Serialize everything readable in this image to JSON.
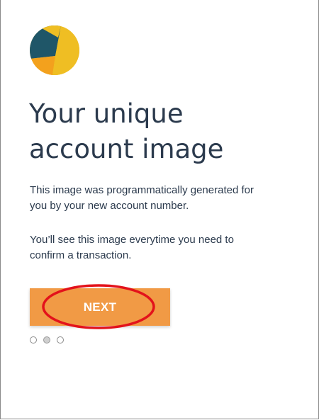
{
  "onboarding": {
    "account_image": {
      "icon": "account-identicon",
      "colors": {
        "yellow": "#efbe23",
        "teal": "#1f5668",
        "orange": "#f3a11d"
      }
    },
    "title_line_1": "Your unique",
    "title_line_2": "account image",
    "paragraph_1_line_1": "This image was programmatically generated for",
    "paragraph_1_line_2": "you by your new account number.",
    "paragraph_2_line_1": "You’ll see this image everytime you need to",
    "paragraph_2_line_2": "confirm a transaction.",
    "next_label": "NEXT",
    "pager": {
      "total": 3,
      "active_index": 2
    }
  },
  "colors": {
    "text": "#2b3a4d",
    "button": "#f19a45",
    "button_text": "#ffffff",
    "highlight": "#e3121b"
  }
}
